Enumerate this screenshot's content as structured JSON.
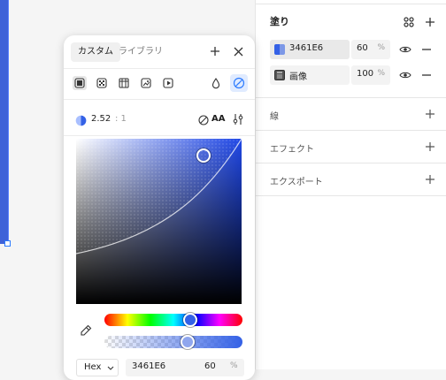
{
  "fill_panel": {
    "title": "塗り",
    "fills": [
      {
        "label": "3461E6",
        "opacity": "60",
        "unit": "%",
        "swatch_color": "#3461E6",
        "type_icon": "solid-swatch"
      },
      {
        "label": "画像",
        "opacity": "100",
        "unit": "%",
        "type_icon": "image-thumbnail"
      }
    ],
    "sections": [
      "線",
      "エフェクト",
      "エクスポート"
    ]
  },
  "picker": {
    "tabs": [
      "カスタム",
      "ライブラリ"
    ],
    "active_tab": "カスタム",
    "fill_types": [
      "solid-icon",
      "gradient-icon",
      "image-icon",
      "pattern-icon",
      "video-icon"
    ],
    "contrast": {
      "ratio": "2.52",
      "suffix": ": 1",
      "level": "AA"
    },
    "color_space": "Hex",
    "hex": "3461E6",
    "opacity": "60",
    "unit": "%",
    "hue_fraction": 0.62,
    "opacity_fraction": 0.6,
    "sv": {
      "saturation": 0.77,
      "value": 0.9
    }
  },
  "colors": {
    "accent": "#3461E6",
    "selection": "#2c7bff"
  }
}
